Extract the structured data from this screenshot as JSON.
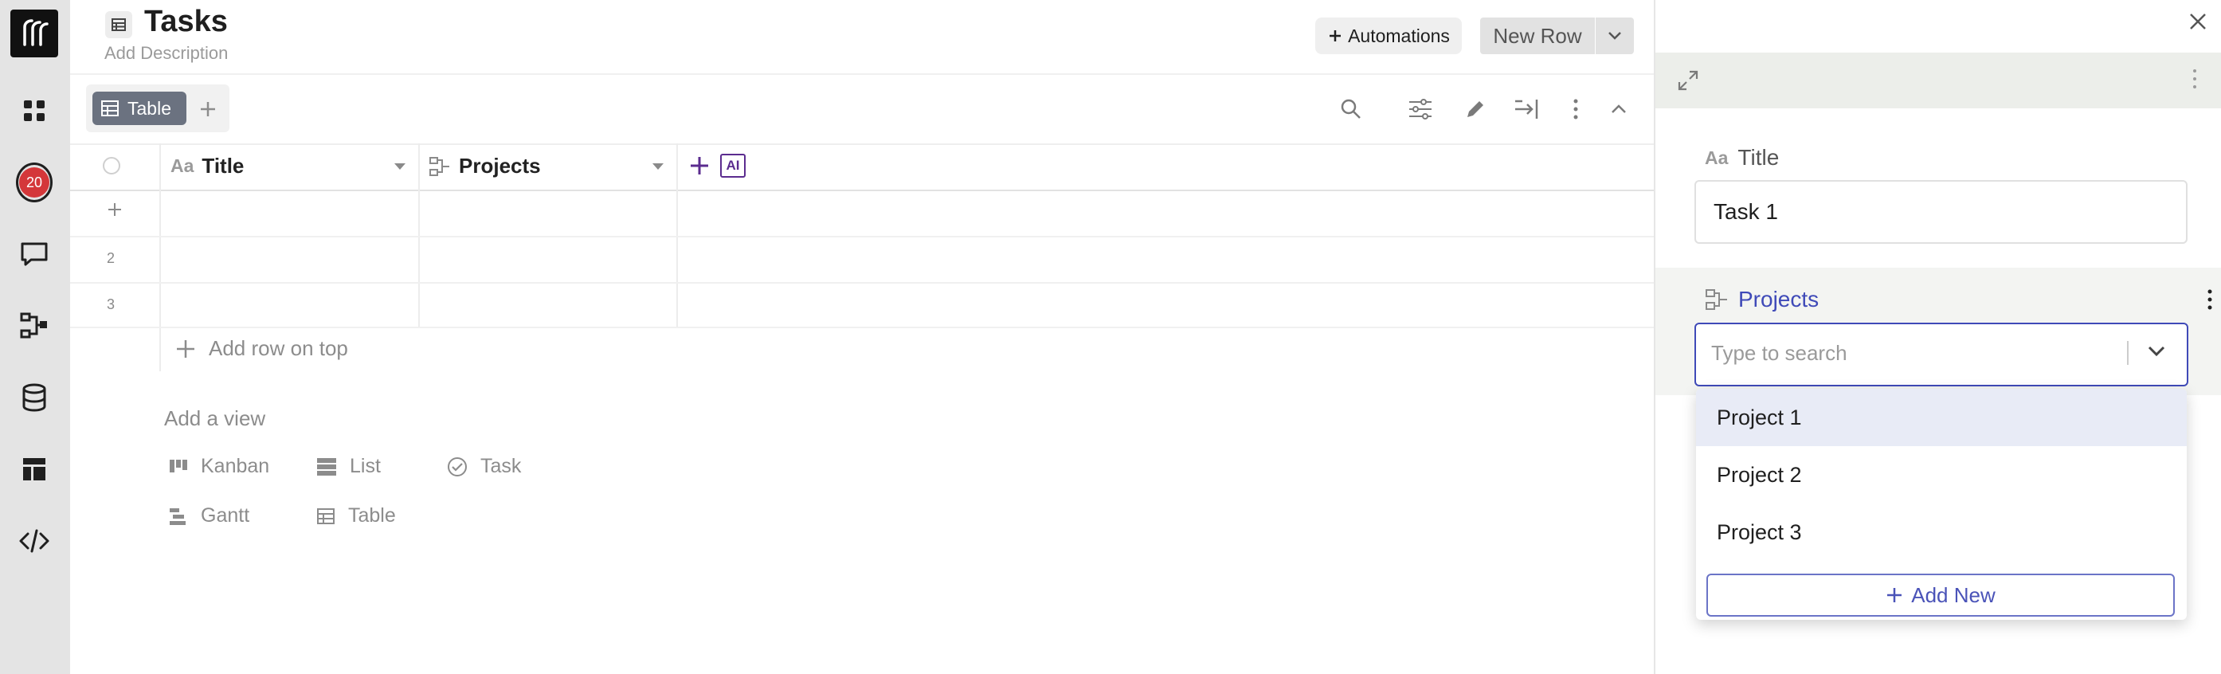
{
  "header": {
    "title": "Tasks",
    "description_placeholder": "Add Description",
    "automations_label": "Automations",
    "new_row_label": "New Row"
  },
  "rail": {
    "notification_count": "20"
  },
  "views": {
    "active_tab": "Table"
  },
  "grid": {
    "columns": [
      {
        "label": "Title",
        "icon": "text-aa-icon"
      },
      {
        "label": "Projects",
        "icon": "link-icon"
      }
    ],
    "ai_label": "AI",
    "rows": [
      "2",
      "3"
    ],
    "add_row_on_top": "Add row on top"
  },
  "add_view": {
    "heading": "Add a view",
    "options": [
      {
        "label": "Kanban",
        "icon": "kanban-icon"
      },
      {
        "label": "List",
        "icon": "list-icon"
      },
      {
        "label": "Task",
        "icon": "check-circle-icon"
      },
      {
        "label": "Gantt",
        "icon": "gantt-icon"
      },
      {
        "label": "Table",
        "icon": "table-icon"
      }
    ]
  },
  "panel": {
    "title_field_label": "Title",
    "title_aa": "Aa",
    "title_value": "Task 1",
    "projects_field_label": "Projects",
    "search_placeholder": "Type to search",
    "options": [
      "Project 1",
      "Project 2",
      "Project 3"
    ],
    "add_new_label": "Add New"
  },
  "colors": {
    "accent": "#3f4ab8",
    "badge": "#d4373a",
    "ai_purple": "#5b2c8f"
  }
}
